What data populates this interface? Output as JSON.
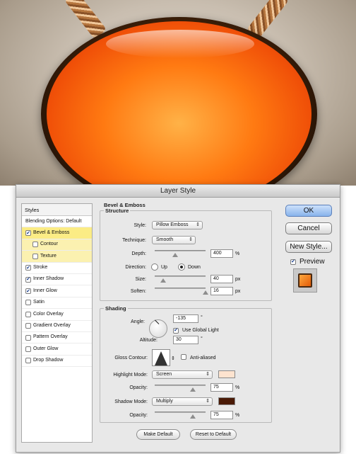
{
  "dialog": {
    "title": "Layer Style"
  },
  "styles_panel": {
    "header": "Styles",
    "items": [
      {
        "label": "Blending Options: Default",
        "checkbox": false,
        "checked": false,
        "highlight": "none",
        "sub": false
      },
      {
        "label": "Bevel & Emboss",
        "checkbox": true,
        "checked": true,
        "highlight": "yellow",
        "sub": false
      },
      {
        "label": "Contour",
        "checkbox": true,
        "checked": false,
        "highlight": "light",
        "sub": true
      },
      {
        "label": "Texture",
        "checkbox": true,
        "checked": false,
        "highlight": "light",
        "sub": true
      },
      {
        "label": "Stroke",
        "checkbox": true,
        "checked": true,
        "highlight": "none",
        "sub": false
      },
      {
        "label": "Inner Shadow",
        "checkbox": true,
        "checked": true,
        "highlight": "none",
        "sub": false
      },
      {
        "label": "Inner Glow",
        "checkbox": true,
        "checked": true,
        "highlight": "none",
        "sub": false
      },
      {
        "label": "Satin",
        "checkbox": true,
        "checked": false,
        "highlight": "none",
        "sub": false
      },
      {
        "label": "Color Overlay",
        "checkbox": true,
        "checked": false,
        "highlight": "none",
        "sub": false
      },
      {
        "label": "Gradient Overlay",
        "checkbox": true,
        "checked": false,
        "highlight": "none",
        "sub": false
      },
      {
        "label": "Pattern Overlay",
        "checkbox": true,
        "checked": false,
        "highlight": "none",
        "sub": false
      },
      {
        "label": "Outer Glow",
        "checkbox": true,
        "checked": false,
        "highlight": "none",
        "sub": false
      },
      {
        "label": "Drop Shadow",
        "checkbox": true,
        "checked": false,
        "highlight": "none",
        "sub": false
      }
    ]
  },
  "bevel": {
    "section_title": "Bevel & Emboss",
    "structure_title": "Structure",
    "style_label": "Style:",
    "style_value": "Pillow Emboss",
    "technique_label": "Technique:",
    "technique_value": "Smooth",
    "depth_label": "Depth:",
    "depth_value": "400",
    "depth_unit": "%",
    "depth_level": 0.4,
    "direction_label": "Direction:",
    "direction_up": "Up",
    "direction_down": "Down",
    "direction_selected": "Down",
    "size_label": "Size:",
    "size_value": "40",
    "size_unit": "px",
    "size_level": 0.16,
    "soften_label": "Soften:",
    "soften_value": "16",
    "soften_unit": "px",
    "soften_level": 1.0
  },
  "shading": {
    "title": "Shading",
    "angle_label": "Angle:",
    "angle_value": "-135",
    "angle_unit": "°",
    "global_light_label": "Use Global Light",
    "global_light_checked": true,
    "altitude_label": "Altitude:",
    "altitude_value": "30",
    "altitude_unit": "°",
    "gloss_contour_label": "Gloss Contour:",
    "anti_aliased_label": "Anti-aliased",
    "anti_aliased_checked": false,
    "highlight_mode_label": "Highlight Mode:",
    "highlight_mode_value": "Screen",
    "highlight_color": "#fde3cf",
    "highlight_opacity_label": "Opacity:",
    "highlight_opacity_value": "75",
    "highlight_opacity_unit": "%",
    "highlight_opacity_level": 0.75,
    "shadow_mode_label": "Shadow Mode:",
    "shadow_mode_value": "Multiply",
    "shadow_color": "#4a1a06",
    "shadow_opacity_label": "Opacity:",
    "shadow_opacity_value": "75",
    "shadow_opacity_unit": "%",
    "shadow_opacity_level": 0.75
  },
  "footer_buttons": {
    "make_default": "Make Default",
    "reset_default": "Reset to Default"
  },
  "side_buttons": {
    "ok": "OK",
    "cancel": "Cancel",
    "new_style": "New Style...",
    "preview_label": "Preview",
    "preview_checked": true
  },
  "icons": {
    "popup_arrow": "⇕",
    "checkmark": "✔"
  }
}
